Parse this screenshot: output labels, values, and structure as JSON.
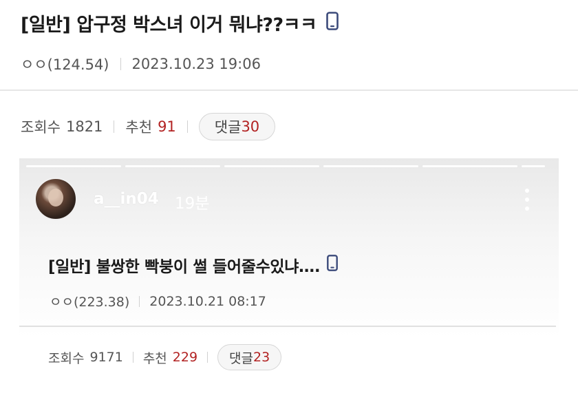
{
  "post": {
    "title": "[일반] 압구정 박스녀 이거 뭐냐??ㅋㅋ",
    "author": "ㅇㅇ(124.54)",
    "datetime": "2023.10.23 19:06",
    "views_label": "조회수",
    "views": "1821",
    "recommend_label": "추천",
    "recommend": "91",
    "comments_label": "댓글",
    "comments": "30"
  },
  "embed": {
    "username": "a__in04",
    "time_ago": "19분",
    "inner_post": {
      "title": "[일반] 불쌍한 빡붕이 썰 들어줄수있냐….",
      "author": "ㅇㅇ(223.38)",
      "datetime": "2023.10.21 08:17",
      "views_label": "조회수",
      "views": "9171",
      "recommend_label": "추천",
      "recommend": "229",
      "comments_label": "댓글",
      "comments": "23"
    }
  },
  "colors": {
    "accent_red": "#b22222",
    "phone_icon": "#3b4a7a",
    "divider": "#e6e6e6"
  },
  "icons": [
    "mobile-phone-icon",
    "more-vertical-icon"
  ]
}
